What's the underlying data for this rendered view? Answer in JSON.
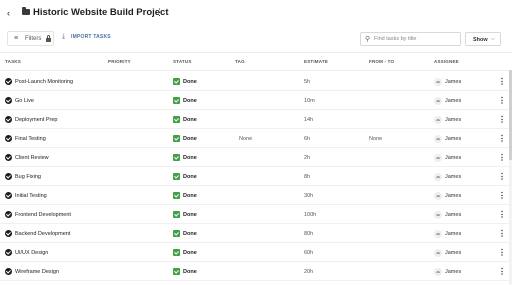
{
  "header": {
    "back_icon": "arrow-left-icon",
    "folder_icon": "folder-icon",
    "title": "Historic Website Build Project",
    "more_icon": "more-vertical-icon"
  },
  "toolbar": {
    "filters_label": "Filters",
    "filter_icon": "filter-icon",
    "lock_icon": "lock-icon",
    "import_label": "IMPORT TASKS",
    "import_icon": "import-icon",
    "search_placeholder": "Find tasks by title",
    "search_value": "",
    "search_icon": "search-icon",
    "show_label": "Show",
    "show_icon": "chevron-down-icon"
  },
  "table": {
    "columns": {
      "tasks": "TASKS",
      "priority": "PRIORITY",
      "status": "STATUS",
      "tag": "TAG",
      "estimate": "ESTIMATE",
      "from_to": "FROM - TO",
      "assignee": "ASSIGNEE"
    },
    "rows": [
      {
        "task": "Post-Launch Monitoring",
        "priority": "",
        "status": "Done",
        "tag": "",
        "estimate": "5h",
        "from_to": "",
        "avatar": "JA",
        "assignee": "James"
      },
      {
        "task": "Go Live",
        "priority": "",
        "status": "Done",
        "tag": "",
        "estimate": "10m",
        "from_to": "",
        "avatar": "JA",
        "assignee": "James"
      },
      {
        "task": "Deployment Prep",
        "priority": "",
        "status": "Done",
        "tag": "",
        "estimate": "14h",
        "from_to": "",
        "avatar": "JA",
        "assignee": "James"
      },
      {
        "task": "Final Testing",
        "priority": "",
        "status": "Done",
        "tag": "None",
        "estimate": "6h",
        "from_to": "None",
        "avatar": "JA",
        "assignee": "James"
      },
      {
        "task": "Client Review",
        "priority": "",
        "status": "Done",
        "tag": "",
        "estimate": "2h",
        "from_to": "",
        "avatar": "JA",
        "assignee": "James"
      },
      {
        "task": "Bug Fixing",
        "priority": "",
        "status": "Done",
        "tag": "",
        "estimate": "8h",
        "from_to": "",
        "avatar": "JA",
        "assignee": "James"
      },
      {
        "task": "Initial Testing",
        "priority": "",
        "status": "Done",
        "tag": "",
        "estimate": "30h",
        "from_to": "",
        "avatar": "JA",
        "assignee": "James"
      },
      {
        "task": "Frontend Development",
        "priority": "",
        "status": "Done",
        "tag": "",
        "estimate": "100h",
        "from_to": "",
        "avatar": "JA",
        "assignee": "James"
      },
      {
        "task": "Backend Development",
        "priority": "",
        "status": "Done",
        "tag": "",
        "estimate": "80h",
        "from_to": "",
        "avatar": "JA",
        "assignee": "James"
      },
      {
        "task": "UI/UX Design",
        "priority": "",
        "status": "Done",
        "tag": "",
        "estimate": "60h",
        "from_to": "",
        "avatar": "JA",
        "assignee": "James"
      },
      {
        "task": "Wireframe Design",
        "priority": "",
        "status": "Done",
        "tag": "",
        "estimate": "20h",
        "from_to": "",
        "avatar": "JA",
        "assignee": "James"
      }
    ]
  },
  "colors": {
    "status_done": "#43a047",
    "accent": "#4a6fa5",
    "text": "#222222"
  }
}
